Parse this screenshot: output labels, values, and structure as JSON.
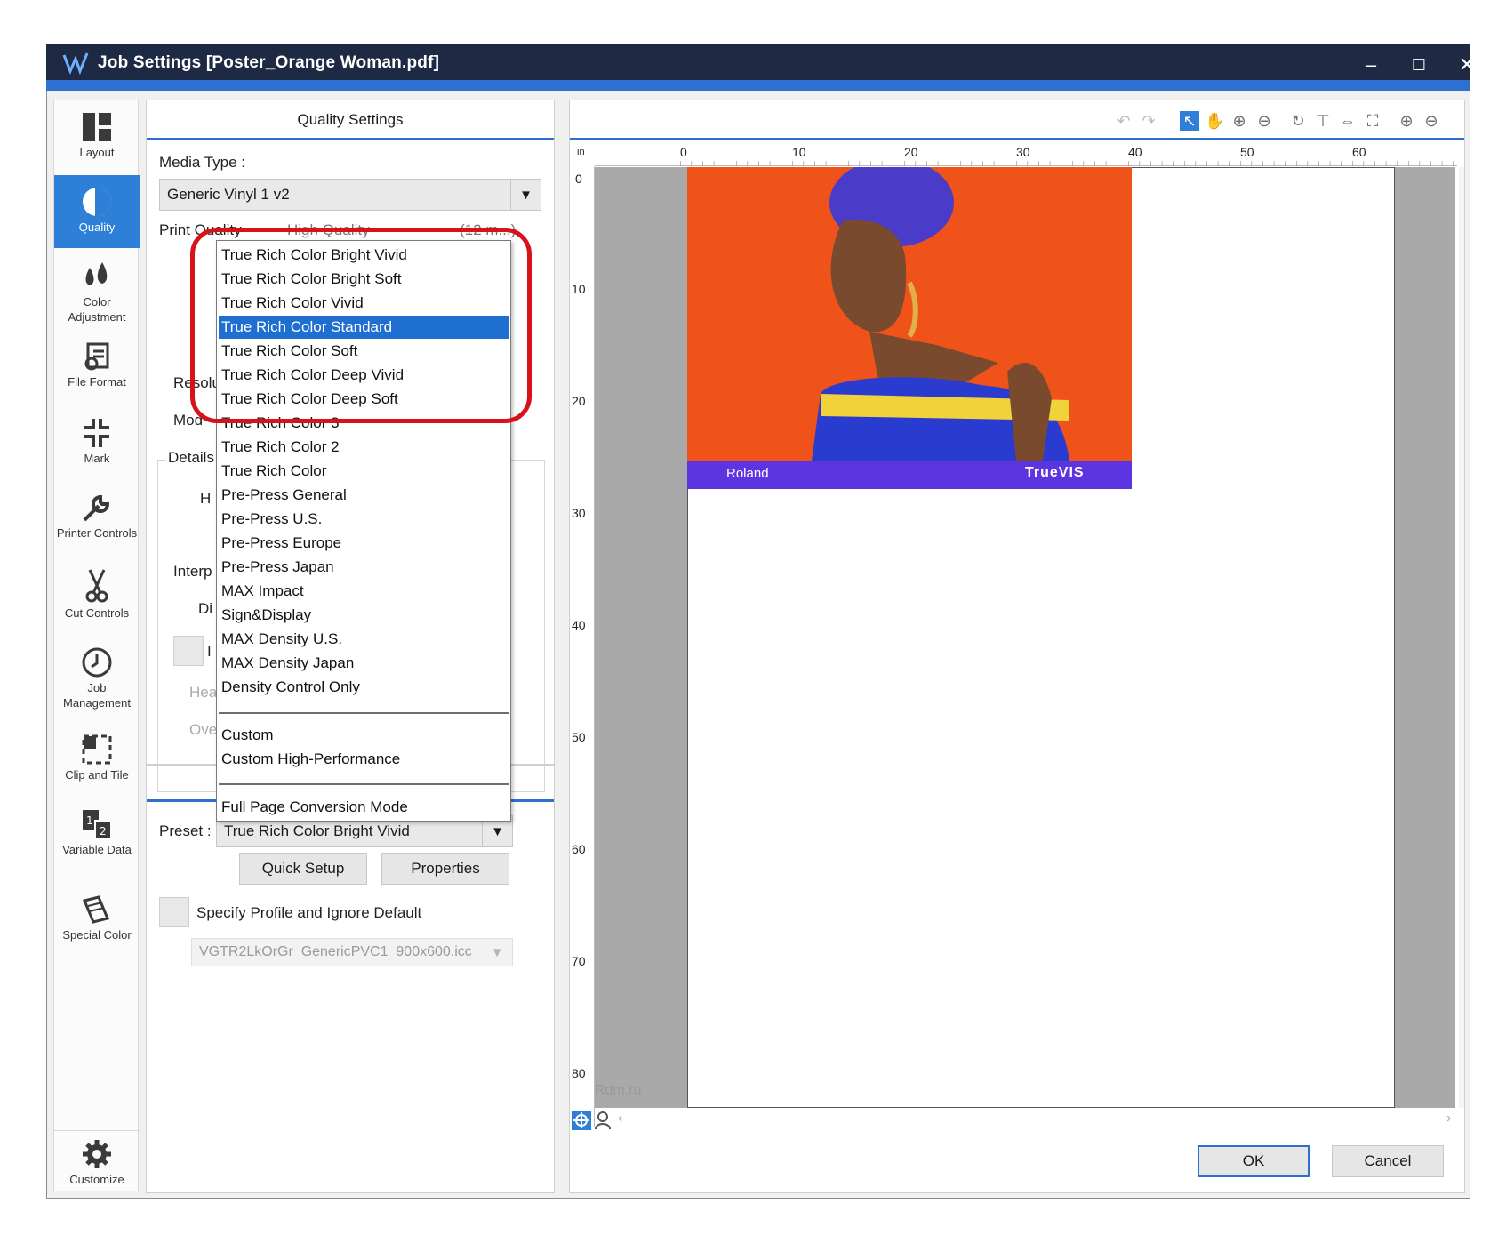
{
  "window": {
    "title": "Job Settings [Poster_Orange Woman.pdf]",
    "controls": {
      "minimize": "–",
      "maximize": "☐",
      "close": "✕"
    }
  },
  "sidebar": {
    "items": [
      {
        "label": "Layout",
        "icon": "layout-icon"
      },
      {
        "label": "Quality",
        "icon": "quality-icon"
      },
      {
        "label": "Color Adjustment",
        "icon": "color-adjustment-icon"
      },
      {
        "label": "File Format",
        "icon": "file-format-icon"
      },
      {
        "label": "Mark",
        "icon": "mark-icon"
      },
      {
        "label": "Printer Controls",
        "icon": "wrench-icon"
      },
      {
        "label": "Cut Controls",
        "icon": "scissors-icon"
      },
      {
        "label": "Job Management",
        "icon": "clock-icon"
      },
      {
        "label": "Clip and Tile",
        "icon": "clip-tile-icon"
      },
      {
        "label": "Variable Data",
        "icon": "variable-data-icon"
      },
      {
        "label": "Special Color",
        "icon": "special-color-icon"
      }
    ],
    "customize_label": "Customize",
    "active": "Quality"
  },
  "quality": {
    "panel_title": "Quality Settings",
    "media_type_label": "Media Type :",
    "media_type_value": "Generic Vinyl 1 v2",
    "print_quality_label": "Print Quality",
    "print_quality_value": "High Quality",
    "print_quality_extra": "(12 m...)",
    "partial_labels": {
      "resolution": "Resolu",
      "mode": "Mod",
      "details": "Details",
      "h": "H",
      "interp": "Interp",
      "di": "Di",
      "i": "I",
      "hea": "Hea",
      "ove": "Ove"
    },
    "preset_label": "Preset :",
    "preset_value": "True Rich Color Bright Vivid",
    "quick_setup_label": "Quick Setup",
    "properties_label": "Properties",
    "specify_profile_label": "Specify Profile and Ignore Default",
    "profile_value": "VGTR2LkOrGr_GenericPVC1_900x600.icc"
  },
  "dropdown": {
    "items": [
      "True Rich Color Bright Vivid",
      "True Rich Color Bright Soft",
      "True Rich Color Vivid",
      "True Rich Color Standard",
      "True Rich Color Soft",
      "True Rich Color Deep Vivid",
      "True Rich Color Deep Soft",
      "True Rich Color 3",
      "True Rich Color 2",
      "True Rich Color",
      "Pre-Press General",
      "Pre-Press U.S.",
      "Pre-Press Europe",
      "Pre-Press Japan",
      "MAX Impact",
      "Sign&Display",
      "MAX Density U.S.",
      "MAX Density Japan",
      "Density Control Only"
    ],
    "custom_items": [
      "Custom",
      "Custom High-Performance"
    ],
    "full_page_item": "Full Page Conversion Mode",
    "selected": "True Rich Color Standard"
  },
  "preview": {
    "ruler_unit": "in",
    "ruler_h_labels": [
      "0",
      "10",
      "20",
      "30",
      "40",
      "50",
      "60"
    ],
    "ruler_v_labels": [
      "0",
      "10",
      "20",
      "30",
      "40",
      "50",
      "60",
      "70",
      "80"
    ],
    "image_brand_left": "Roland",
    "image_brand_right": "TrueVIS",
    "watermark": "Rdm.ru"
  },
  "footer": {
    "ok_label": "OK",
    "cancel_label": "Cancel"
  },
  "colors": {
    "accent": "#2f6fd0",
    "selection": "#1f6fd1",
    "highlight_ring": "#d8121b",
    "titlebar": "#1e2a44"
  }
}
